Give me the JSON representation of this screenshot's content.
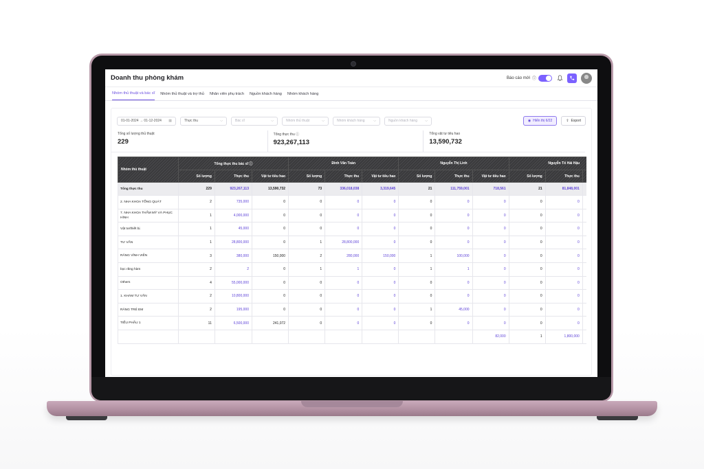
{
  "app": {
    "title": "Doanh thu phòng khám",
    "new_report_label": "Báo cáo mới",
    "accent": "#7b61ff"
  },
  "tabs": [
    {
      "label": "Nhóm thủ thuật và bác sĩ",
      "active": true
    },
    {
      "label": "Nhóm thủ thuật và trợ thủ",
      "active": false
    },
    {
      "label": "Nhân viên phụ trách",
      "active": false
    },
    {
      "label": "Nguồn khách hàng",
      "active": false
    },
    {
      "label": "Nhóm khách hàng",
      "active": false
    }
  ],
  "filters": {
    "date_range": "01-01-2024 → 01-12-2024",
    "metric": "Thực thu",
    "doctor_placeholder": "Bác sĩ",
    "procedure_group_placeholder": "Nhóm thủ thuật",
    "customer_group_placeholder": "Nhóm khách hàng",
    "customer_source_placeholder": "Nguồn khách hàng",
    "show_button": "Hiển thị 6/22",
    "export_button": "Export"
  },
  "kpis": [
    {
      "label": "Tổng số lượng thủ thuật",
      "value": "229"
    },
    {
      "label": "Tổng thực thu",
      "value": "923,267,113"
    },
    {
      "label": "Tổng vật tư tiêu hao",
      "value": "13,590,732"
    }
  ],
  "table": {
    "first_header": "Nhóm thủ thuật",
    "groups": [
      {
        "name": "Tổng thực thu bác sĩ"
      },
      {
        "name": "Đinh Văn Toàn"
      },
      {
        "name": "Nguyễn Thị Linh"
      },
      {
        "name": "Nguyễn Tố Hải Hậu"
      }
    ],
    "sub_headers": [
      "Số lượng",
      "Thực thu",
      "Vật tư tiêu hao"
    ],
    "rows": [
      {
        "name": "Tổng thực thu",
        "cells": [
          "229",
          "923,267,113",
          "13,590,732",
          "73",
          "336,018,038",
          "3,319,645",
          "21",
          "111,759,001",
          "718,561",
          "21",
          "81,848,001"
        ]
      },
      {
        "name": "2. NHA KHOA TỔNG QUÁT",
        "cells": [
          "2",
          "735,000",
          "0",
          "0",
          "0",
          "0",
          "0",
          "0",
          "0",
          "0",
          "0"
        ]
      },
      {
        "name": "7. NHA KHOA THẨM MỸ VÀ PHỤC HÌNH",
        "cells": [
          "1",
          "4,000,000",
          "0",
          "0",
          "0",
          "0",
          "0",
          "0",
          "0",
          "0",
          "0"
        ]
      },
      {
        "name": "Vật tư/thiết bị",
        "cells": [
          "1",
          "45,000",
          "0",
          "0",
          "0",
          "0",
          "0",
          "0",
          "0",
          "0",
          "0"
        ]
      },
      {
        "name": "TƯ VẤN",
        "cells": [
          "1",
          "28,800,000",
          "0",
          "1",
          "28,800,000",
          "0",
          "0",
          "0",
          "0",
          "0",
          "0"
        ]
      },
      {
        "name": "RĂNG VĨNH VIỄN",
        "cells": [
          "3",
          "380,000",
          "150,000",
          "2",
          "280,000",
          "150,000",
          "1",
          "100,000",
          "0",
          "0",
          "0"
        ]
      },
      {
        "name": "bọc răng hàm",
        "cells": [
          "2",
          "2",
          "0",
          "1",
          "1",
          "0",
          "1",
          "1",
          "0",
          "0",
          "0"
        ]
      },
      {
        "name": "Others",
        "cells": [
          "4",
          "55,000,000",
          "0",
          "0",
          "0",
          "0",
          "0",
          "0",
          "0",
          "0",
          "0"
        ]
      },
      {
        "name": "1. KHÁM TƯ VẤN",
        "cells": [
          "2",
          "10,800,000",
          "0",
          "0",
          "0",
          "0",
          "0",
          "0",
          "0",
          "0",
          "0"
        ]
      },
      {
        "name": "RĂNG TRẺ EM",
        "cells": [
          "2",
          "195,000",
          "0",
          "0",
          "0",
          "0",
          "1",
          "45,000",
          "0",
          "0",
          "0"
        ]
      },
      {
        "name": "TIỂU PHẪU 1",
        "cells": [
          "11",
          "6,500,000",
          "241,072",
          "0",
          "0",
          "0",
          "0",
          "0",
          "0",
          "0",
          "0"
        ]
      }
    ],
    "partial_row": {
      "cells": [
        "82,000",
        "1",
        "1,800,000"
      ]
    }
  }
}
